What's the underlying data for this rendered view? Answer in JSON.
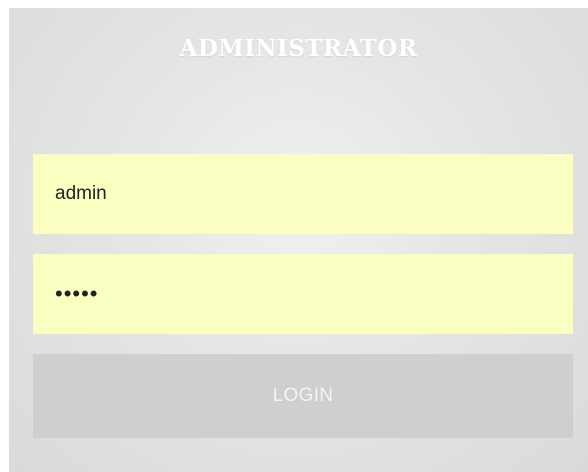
{
  "login_form": {
    "title": "ADMINISTRATOR",
    "username": {
      "value": "admin"
    },
    "password": {
      "value": "•••••"
    },
    "submit_label": "LOGIN"
  },
  "colors": {
    "field_background": "#fafec0",
    "button_background": "#cfcfcf",
    "title_color": "#ffffff",
    "panel_background": "#e2e3e3"
  }
}
